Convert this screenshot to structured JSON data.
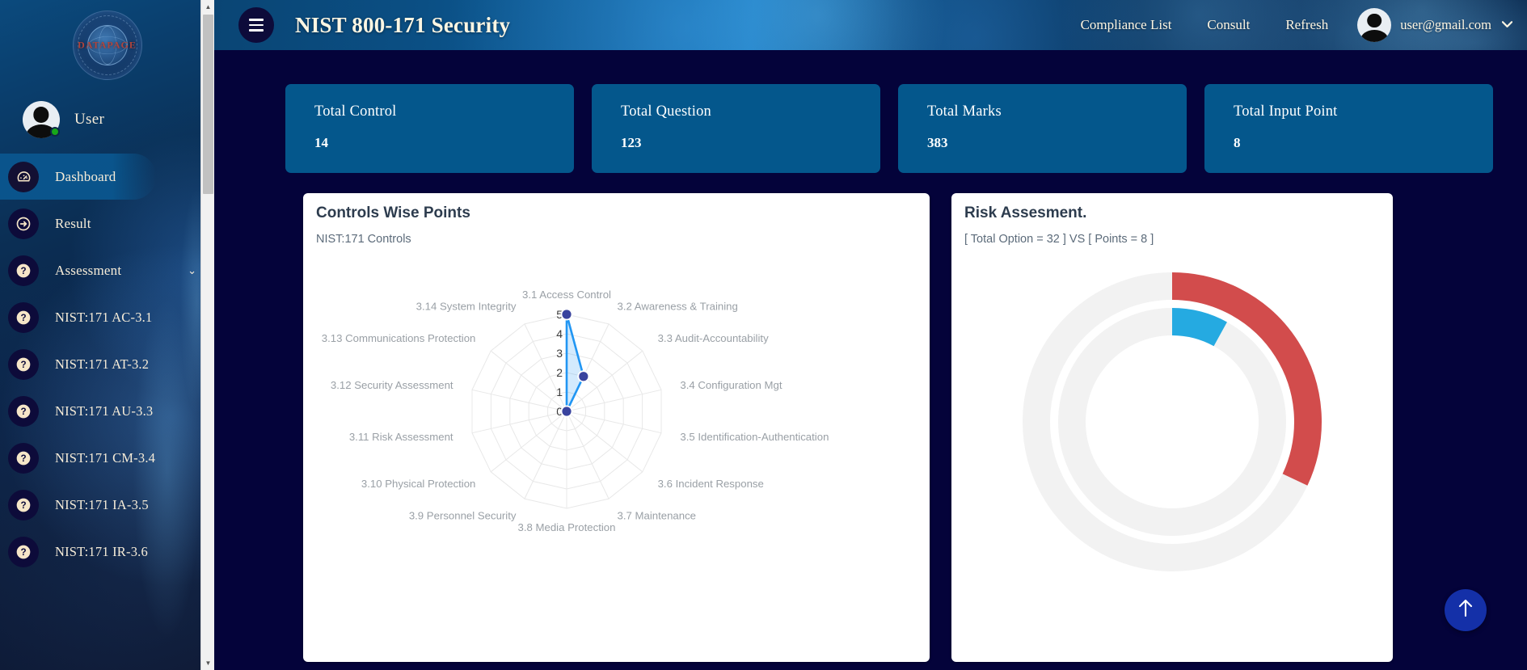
{
  "brand": {
    "title": "NIST 800-171 Security",
    "logo_word": "DATAPAGE",
    "menu_icon": "hamburger-icon"
  },
  "topnav": {
    "links": [
      {
        "label": "Compliance List"
      },
      {
        "label": "Consult"
      },
      {
        "label": "Refresh"
      }
    ],
    "user_email": "user@gmail.com",
    "caret": "⌄"
  },
  "sidebar": {
    "user_name": "User",
    "items": [
      {
        "label": "Dashboard",
        "icon": "dashboard-gauge-icon",
        "active": true,
        "chevron": ""
      },
      {
        "label": "Result",
        "icon": "arrow-right-circle-icon",
        "active": false,
        "chevron": ""
      },
      {
        "label": "Assessment",
        "icon": "question-circle-icon",
        "active": false,
        "chevron": "⌄"
      },
      {
        "label": "NIST:171 AC-3.1",
        "icon": "question-circle-icon",
        "active": false,
        "chevron": ""
      },
      {
        "label": "NIST:171 AT-3.2",
        "icon": "question-circle-icon",
        "active": false,
        "chevron": ""
      },
      {
        "label": "NIST:171 AU-3.3",
        "icon": "question-circle-icon",
        "active": false,
        "chevron": ""
      },
      {
        "label": "NIST:171 CM-3.4",
        "icon": "question-circle-icon",
        "active": false,
        "chevron": ""
      },
      {
        "label": "NIST:171 IA-3.5",
        "icon": "question-circle-icon",
        "active": false,
        "chevron": ""
      },
      {
        "label": "NIST:171 IR-3.6",
        "icon": "question-circle-icon",
        "active": false,
        "chevron": ""
      }
    ]
  },
  "stats": [
    {
      "title": "Total Control",
      "value": "14"
    },
    {
      "title": "Total Question",
      "value": "123"
    },
    {
      "title": "Total Marks",
      "value": "383"
    },
    {
      "title": "Total Input Point",
      "value": "8"
    }
  ],
  "panels": {
    "left": {
      "title": "Controls Wise Points",
      "subtitle": "NIST:171 Controls"
    },
    "right": {
      "title": "Risk Assesment.",
      "subtitle": "[ Total Option = 32 ] VS [ Points = 8 ]"
    }
  },
  "colors": {
    "accent_blue": "#0a568e",
    "card_blue": "#04578c",
    "radar_line": "#2196f3",
    "radar_point": "#39439e",
    "donut_red": "#d24c4c",
    "donut_blue": "#25aae1",
    "donut_track": "#f2f2f2",
    "scroll_top": "#1430a8"
  },
  "chart_data": [
    {
      "type": "radar",
      "title": "Controls Wise Points",
      "subtitle": "NIST:171 Controls",
      "categories": [
        "3.1 Access Control",
        "3.2 Awareness & Training",
        "3.3 Audit-Accountability",
        "3.4 Configuration Mgt",
        "3.5 Identification-Authentication",
        "3.6 Incident Response",
        "3.7 Maintenance",
        "3.8 Media Protection",
        "3.9 Personnel Security",
        "3.10 Physical Protection",
        "3.11 Risk Assessment",
        "3.12 Security Assessment",
        "3.13 Communications Protection",
        "3.14 System Integrity"
      ],
      "values": [
        5,
        2,
        0,
        0,
        0,
        0,
        0,
        0,
        0,
        0,
        0,
        0,
        0,
        0
      ],
      "ticks": [
        "0",
        "1",
        "2",
        "3",
        "4",
        "5"
      ],
      "rmin": 0,
      "rmax": 5,
      "grid": true,
      "legend": "none",
      "series": [
        {
          "name": "Points",
          "values": [
            5,
            2,
            0,
            0,
            0,
            0,
            0,
            0,
            0,
            0,
            0,
            0,
            0,
            0
          ]
        }
      ]
    },
    {
      "type": "pie",
      "title": "Risk Assesment.",
      "subtitle": "[ Total Option = 32 ] VS [ Points = 8 ]",
      "variant": "nested-donut-gauge",
      "series": [
        {
          "name": "Total Option",
          "value": 32,
          "max": 100,
          "percent": 32,
          "color": "#d24c4c",
          "ring": "outer"
        },
        {
          "name": "Points",
          "value": 8,
          "max": 100,
          "percent": 8,
          "color": "#25aae1",
          "ring": "inner"
        }
      ],
      "legend": "none",
      "grid": false
    }
  ],
  "scroll_top": {
    "icon": "arrow-up-icon",
    "label": "↑"
  }
}
